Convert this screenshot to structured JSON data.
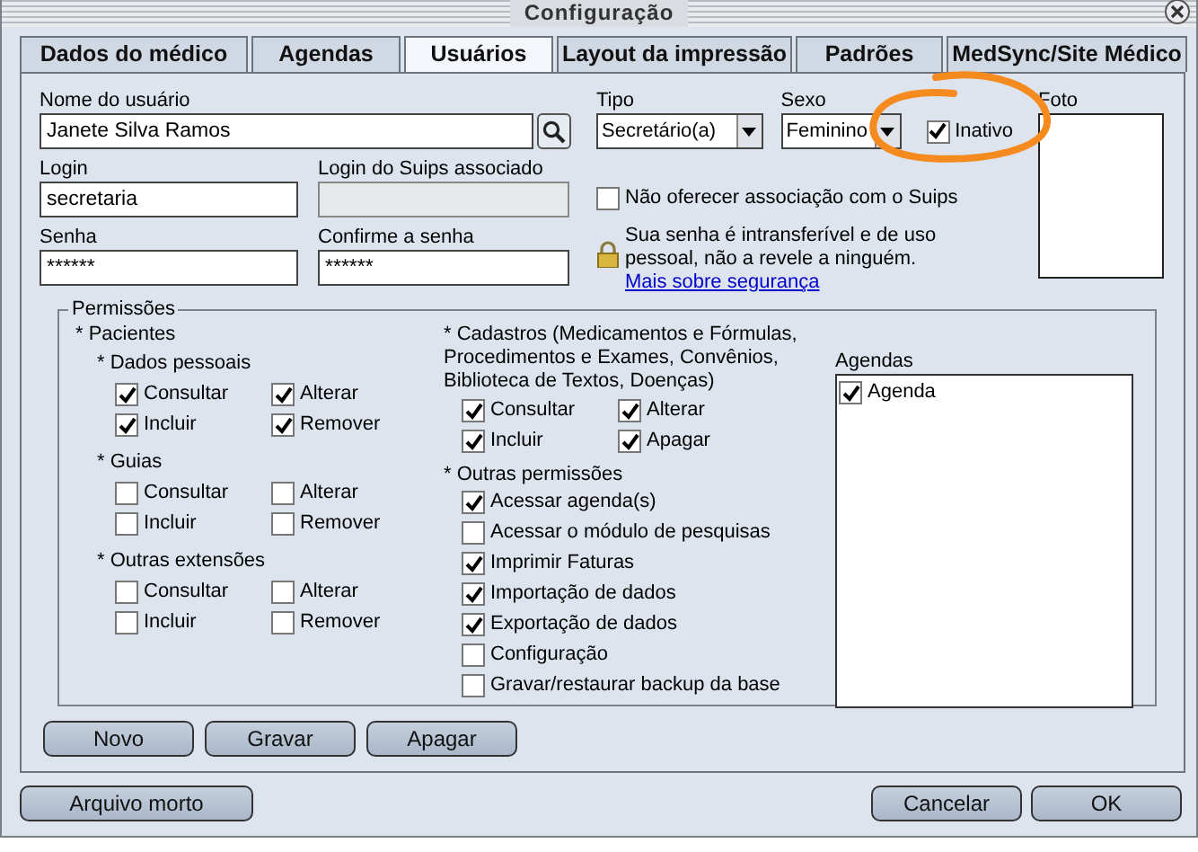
{
  "window": {
    "title": "Configuração"
  },
  "tabs": [
    {
      "label": "Dados do médico",
      "selected": false
    },
    {
      "label": "Agendas",
      "selected": false
    },
    {
      "label": "Usuários",
      "selected": true
    },
    {
      "label": "Layout da impressão",
      "selected": false
    },
    {
      "label": "Padrões",
      "selected": false
    },
    {
      "label": "MedSync/Site Médico",
      "selected": false
    }
  ],
  "user_form": {
    "name": {
      "label": "Nome do usuário",
      "value": "Janete Silva Ramos"
    },
    "type": {
      "label": "Tipo",
      "value": "Secretário(a)"
    },
    "sex": {
      "label": "Sexo",
      "value": "Feminino"
    },
    "inactive": {
      "label": "Inativo",
      "checked": true
    },
    "photo": {
      "label": "Foto"
    },
    "login": {
      "label": "Login",
      "value": "secretaria"
    },
    "suips_login": {
      "label": "Login do Suips associado",
      "disabled": true
    },
    "no_suips": {
      "label": "Não oferecer associação com o Suips",
      "checked": false
    },
    "password": {
      "label": "Senha",
      "value": "******"
    },
    "confirm_password": {
      "label": "Confirme a senha",
      "value": "******"
    },
    "security_note": "Sua senha é intransferível e de uso pessoal, não a revele a ninguém.",
    "security_link": "Mais sobre segurança"
  },
  "permissions": {
    "title": "Permissões",
    "patients": {
      "title": "* Pacientes",
      "subgroups": [
        {
          "title": "* Dados pessoais",
          "options": [
            {
              "label": "Consultar",
              "checked": true
            },
            {
              "label": "Alterar",
              "checked": true
            },
            {
              "label": "Incluir",
              "checked": true
            },
            {
              "label": "Remover",
              "checked": true
            }
          ]
        },
        {
          "title": "* Guias",
          "options": [
            {
              "label": "Consultar",
              "checked": false
            },
            {
              "label": "Alterar",
              "checked": false
            },
            {
              "label": "Incluir",
              "checked": false
            },
            {
              "label": "Remover",
              "checked": false
            }
          ]
        },
        {
          "title": "* Outras extensões",
          "options": [
            {
              "label": "Consultar",
              "checked": false
            },
            {
              "label": "Alterar",
              "checked": false
            },
            {
              "label": "Incluir",
              "checked": false
            },
            {
              "label": "Remover",
              "checked": false
            }
          ]
        }
      ]
    },
    "registries": {
      "title": "* Cadastros (Medicamentos e Fórmulas, Procedimentos e Exames, Convênios, Biblioteca de Textos, Doenças)",
      "options": [
        {
          "label": "Consultar",
          "checked": true
        },
        {
          "label": "Alterar",
          "checked": true
        },
        {
          "label": "Incluir",
          "checked": true
        },
        {
          "label": "Apagar",
          "checked": true
        }
      ]
    },
    "other": {
      "title": "* Outras permissões",
      "options": [
        {
          "label": "Acessar agenda(s)",
          "checked": true
        },
        {
          "label": "Acessar o módulo de pesquisas",
          "checked": false
        },
        {
          "label": "Imprimir Faturas",
          "checked": true
        },
        {
          "label": "Importação de dados",
          "checked": true
        },
        {
          "label": "Exportação de dados",
          "checked": true
        },
        {
          "label": "Configuração",
          "checked": false
        },
        {
          "label": "Gravar/restaurar backup da base",
          "checked": false
        }
      ]
    },
    "agendas": {
      "label": "Agendas",
      "items": [
        {
          "label": "Agenda",
          "checked": true
        }
      ]
    }
  },
  "form_buttons": [
    "Novo",
    "Gravar",
    "Apagar"
  ],
  "footer": {
    "left": [
      "Arquivo morto"
    ],
    "right": [
      "Cancelar",
      "OK"
    ]
  }
}
